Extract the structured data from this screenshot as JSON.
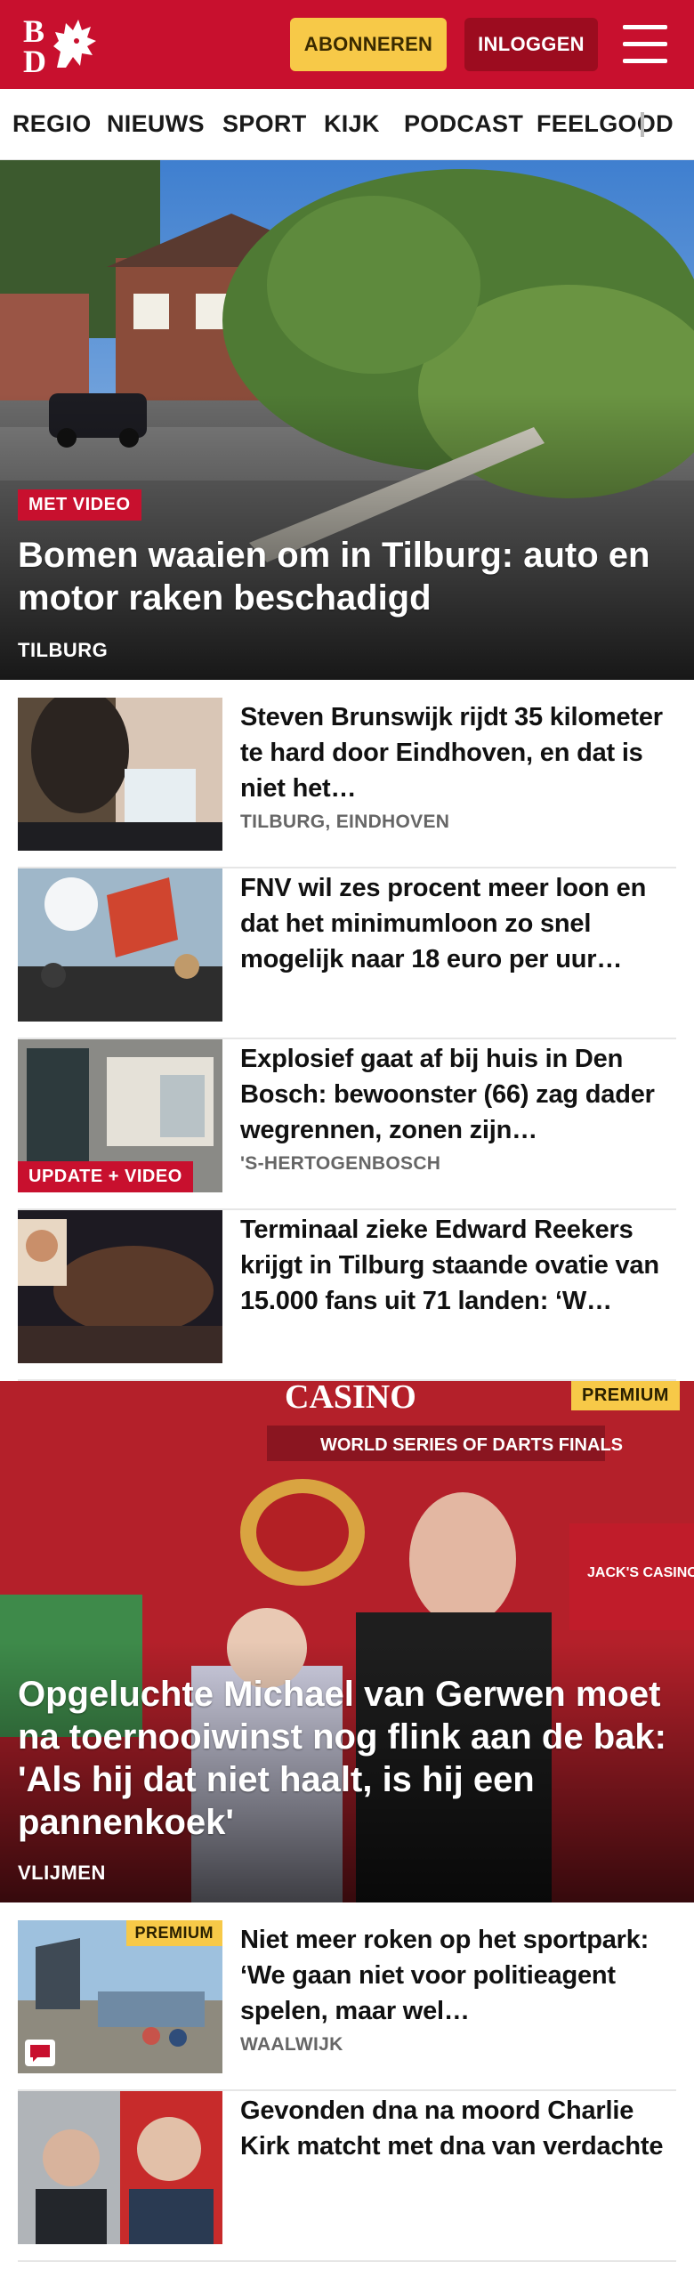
{
  "header": {
    "logo_top": "B",
    "logo_bottom": "D",
    "subscribe_label": "ABONNEREN",
    "login_label": "INLOGGEN"
  },
  "nav": {
    "items": [
      "REGIO",
      "NIEUWS",
      "SPORT",
      "KIJK",
      "PODCAST",
      "FEELGOOD"
    ]
  },
  "hero": {
    "badge": "MET VIDEO",
    "title": "Bomen waaien om in Tilburg: auto en motor raken beschadigd",
    "location": "TILBURG"
  },
  "articles": [
    {
      "title": "Steven Brunswijk rijdt 35 kilometer te hard door Eindhoven, en dat is niet het…",
      "location": "TILBURG, EINDHOVEN"
    },
    {
      "title": "FNV wil zes procent meer loon en dat het minimumloon zo snel mogelijk naar 18 euro per uur…",
      "location": ""
    },
    {
      "badge": "UPDATE + VIDEO",
      "title": "Explosief gaat af bij huis in Den Bosch: bewoonster (66) zag dader wegrennen, zonen zijn…",
      "location": "'S-HERTOGENBOSCH"
    },
    {
      "title": "Terminaal zieke Edward Reekers krijgt in Tilburg staande ovatie van 15.000 fans uit 71 landen: ‘W…",
      "location": ""
    }
  ],
  "feature": {
    "badge": "PREMIUM",
    "sign_top": "CASINO",
    "sign_banner": "WORLD SERIES OF DARTS FINALS",
    "sign_right": "JACK'S CASINO AMSTERDAM",
    "title": "Opgeluchte Michael van Gerwen moet na toernooiwinst nog flink aan de bak: 'Als hij dat niet haalt, is hij een pannenkoek'",
    "location": "VLIJMEN"
  },
  "articles2": [
    {
      "badge": "PREMIUM",
      "title": "Niet meer roken op het sportpark: ‘We gaan niet voor politieagent spelen, maar wel…",
      "location": "WAALWIJK"
    },
    {
      "title": "Gevonden dna na moord Charlie Kirk matcht met dna van verdachte",
      "location": ""
    }
  ],
  "colors": {
    "brand_red": "#c8102e",
    "subscribe_yellow": "#f7c948",
    "login_dark_red": "#9c0c1f"
  },
  "icons": [
    "lion-logo-icon",
    "hamburger-menu-icon",
    "comment-icon"
  ]
}
